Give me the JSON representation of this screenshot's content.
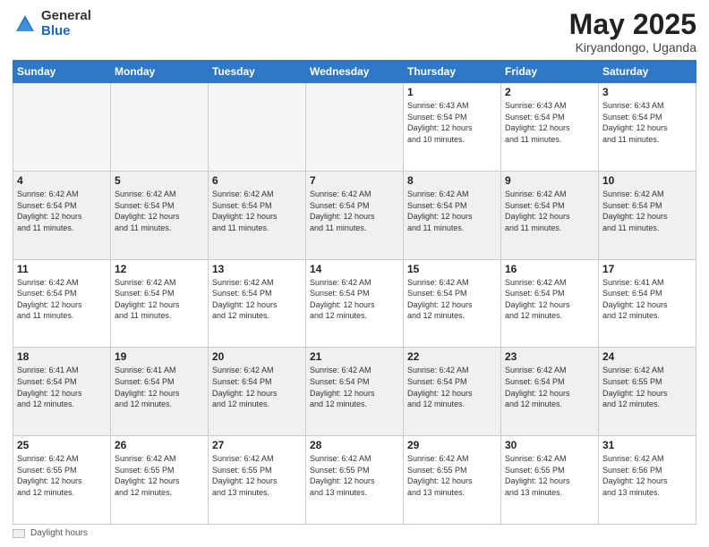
{
  "header": {
    "logo_general": "General",
    "logo_blue": "Blue",
    "month_title": "May 2025",
    "subtitle": "Kiryandongo, Uganda"
  },
  "footer": {
    "daylight_label": "Daylight hours"
  },
  "weekdays": [
    "Sunday",
    "Monday",
    "Tuesday",
    "Wednesday",
    "Thursday",
    "Friday",
    "Saturday"
  ],
  "weeks": [
    [
      {
        "day": "",
        "info": "",
        "empty": true
      },
      {
        "day": "",
        "info": "",
        "empty": true
      },
      {
        "day": "",
        "info": "",
        "empty": true
      },
      {
        "day": "",
        "info": "",
        "empty": true
      },
      {
        "day": "1",
        "info": "Sunrise: 6:43 AM\nSunset: 6:54 PM\nDaylight: 12 hours\nand 10 minutes.",
        "empty": false
      },
      {
        "day": "2",
        "info": "Sunrise: 6:43 AM\nSunset: 6:54 PM\nDaylight: 12 hours\nand 11 minutes.",
        "empty": false
      },
      {
        "day": "3",
        "info": "Sunrise: 6:43 AM\nSunset: 6:54 PM\nDaylight: 12 hours\nand 11 minutes.",
        "empty": false
      }
    ],
    [
      {
        "day": "4",
        "info": "Sunrise: 6:42 AM\nSunset: 6:54 PM\nDaylight: 12 hours\nand 11 minutes.",
        "empty": false
      },
      {
        "day": "5",
        "info": "Sunrise: 6:42 AM\nSunset: 6:54 PM\nDaylight: 12 hours\nand 11 minutes.",
        "empty": false
      },
      {
        "day": "6",
        "info": "Sunrise: 6:42 AM\nSunset: 6:54 PM\nDaylight: 12 hours\nand 11 minutes.",
        "empty": false
      },
      {
        "day": "7",
        "info": "Sunrise: 6:42 AM\nSunset: 6:54 PM\nDaylight: 12 hours\nand 11 minutes.",
        "empty": false
      },
      {
        "day": "8",
        "info": "Sunrise: 6:42 AM\nSunset: 6:54 PM\nDaylight: 12 hours\nand 11 minutes.",
        "empty": false
      },
      {
        "day": "9",
        "info": "Sunrise: 6:42 AM\nSunset: 6:54 PM\nDaylight: 12 hours\nand 11 minutes.",
        "empty": false
      },
      {
        "day": "10",
        "info": "Sunrise: 6:42 AM\nSunset: 6:54 PM\nDaylight: 12 hours\nand 11 minutes.",
        "empty": false
      }
    ],
    [
      {
        "day": "11",
        "info": "Sunrise: 6:42 AM\nSunset: 6:54 PM\nDaylight: 12 hours\nand 11 minutes.",
        "empty": false
      },
      {
        "day": "12",
        "info": "Sunrise: 6:42 AM\nSunset: 6:54 PM\nDaylight: 12 hours\nand 11 minutes.",
        "empty": false
      },
      {
        "day": "13",
        "info": "Sunrise: 6:42 AM\nSunset: 6:54 PM\nDaylight: 12 hours\nand 12 minutes.",
        "empty": false
      },
      {
        "day": "14",
        "info": "Sunrise: 6:42 AM\nSunset: 6:54 PM\nDaylight: 12 hours\nand 12 minutes.",
        "empty": false
      },
      {
        "day": "15",
        "info": "Sunrise: 6:42 AM\nSunset: 6:54 PM\nDaylight: 12 hours\nand 12 minutes.",
        "empty": false
      },
      {
        "day": "16",
        "info": "Sunrise: 6:42 AM\nSunset: 6:54 PM\nDaylight: 12 hours\nand 12 minutes.",
        "empty": false
      },
      {
        "day": "17",
        "info": "Sunrise: 6:41 AM\nSunset: 6:54 PM\nDaylight: 12 hours\nand 12 minutes.",
        "empty": false
      }
    ],
    [
      {
        "day": "18",
        "info": "Sunrise: 6:41 AM\nSunset: 6:54 PM\nDaylight: 12 hours\nand 12 minutes.",
        "empty": false
      },
      {
        "day": "19",
        "info": "Sunrise: 6:41 AM\nSunset: 6:54 PM\nDaylight: 12 hours\nand 12 minutes.",
        "empty": false
      },
      {
        "day": "20",
        "info": "Sunrise: 6:42 AM\nSunset: 6:54 PM\nDaylight: 12 hours\nand 12 minutes.",
        "empty": false
      },
      {
        "day": "21",
        "info": "Sunrise: 6:42 AM\nSunset: 6:54 PM\nDaylight: 12 hours\nand 12 minutes.",
        "empty": false
      },
      {
        "day": "22",
        "info": "Sunrise: 6:42 AM\nSunset: 6:54 PM\nDaylight: 12 hours\nand 12 minutes.",
        "empty": false
      },
      {
        "day": "23",
        "info": "Sunrise: 6:42 AM\nSunset: 6:54 PM\nDaylight: 12 hours\nand 12 minutes.",
        "empty": false
      },
      {
        "day": "24",
        "info": "Sunrise: 6:42 AM\nSunset: 6:55 PM\nDaylight: 12 hours\nand 12 minutes.",
        "empty": false
      }
    ],
    [
      {
        "day": "25",
        "info": "Sunrise: 6:42 AM\nSunset: 6:55 PM\nDaylight: 12 hours\nand 12 minutes.",
        "empty": false
      },
      {
        "day": "26",
        "info": "Sunrise: 6:42 AM\nSunset: 6:55 PM\nDaylight: 12 hours\nand 12 minutes.",
        "empty": false
      },
      {
        "day": "27",
        "info": "Sunrise: 6:42 AM\nSunset: 6:55 PM\nDaylight: 12 hours\nand 13 minutes.",
        "empty": false
      },
      {
        "day": "28",
        "info": "Sunrise: 6:42 AM\nSunset: 6:55 PM\nDaylight: 12 hours\nand 13 minutes.",
        "empty": false
      },
      {
        "day": "29",
        "info": "Sunrise: 6:42 AM\nSunset: 6:55 PM\nDaylight: 12 hours\nand 13 minutes.",
        "empty": false
      },
      {
        "day": "30",
        "info": "Sunrise: 6:42 AM\nSunset: 6:55 PM\nDaylight: 12 hours\nand 13 minutes.",
        "empty": false
      },
      {
        "day": "31",
        "info": "Sunrise: 6:42 AM\nSunset: 6:56 PM\nDaylight: 12 hours\nand 13 minutes.",
        "empty": false
      }
    ]
  ]
}
